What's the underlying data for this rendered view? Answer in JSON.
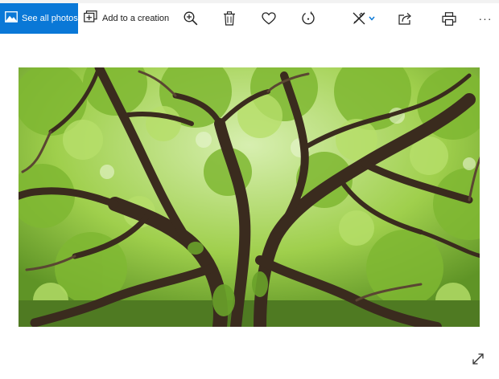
{
  "toolbar": {
    "see_all_photos_label": "See all photos",
    "add_to_creation_label": "Add to a creation",
    "more_label": "···",
    "accent_color": "#0a78d7",
    "icons": [
      "photos-icon",
      "add-to-creation-icon",
      "zoom-in-icon",
      "delete-icon",
      "favorite-heart-icon",
      "rotate-icon",
      "edit-draw-icon",
      "chevron-down-icon",
      "share-icon",
      "print-icon",
      "more-icon",
      "expand-icon"
    ]
  }
}
